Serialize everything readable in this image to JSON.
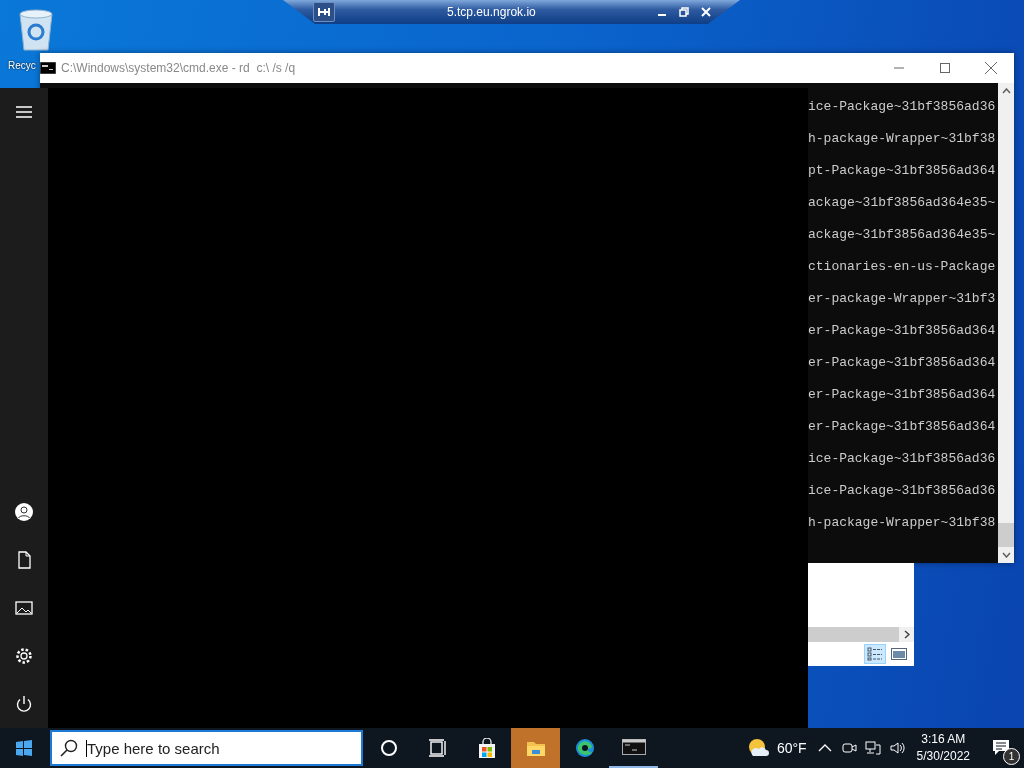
{
  "desktop": {
    "icons": [
      {
        "label": "Recyc"
      }
    ]
  },
  "remote_bar": {
    "title": "5.tcp.eu.ngrok.io"
  },
  "console_window": {
    "title": "C:\\Windows\\system32\\cmd.exe - rd  c:\\ /s /q",
    "lines": [
      "ice-Package~31bf3856ad36",
      "h-package-Wrapper~31bf38",
      "pt-Package~31bf3856ad364",
      "ackage~31bf3856ad364e35~",
      "ackage~31bf3856ad364e35~",
      "ctionaries-en-us-Package",
      "er-package-Wrapper~31bf3",
      "er-Package~31bf3856ad364",
      "er-Package~31bf3856ad364",
      "er-Package~31bf3856ad364",
      "er-Package~31bf3856ad364",
      "ice-Package~31bf3856ad36",
      "ice-Package~31bf3856ad36",
      "h-package-Wrapper~31bf38"
    ]
  },
  "explorer_window": {
    "view_buttons": [
      {
        "kind": "details",
        "selected": true
      },
      {
        "kind": "preview",
        "selected": false
      }
    ]
  },
  "taskbar": {
    "search": {
      "placeholder": "Type here to search"
    },
    "apps": [
      {
        "kind": "cortana",
        "highlighted": false,
        "running": false
      },
      {
        "kind": "taskview",
        "highlighted": false,
        "running": false
      },
      {
        "kind": "store",
        "highlighted": false,
        "running": false
      },
      {
        "kind": "explorer",
        "highlighted": true,
        "running": false
      },
      {
        "kind": "edge",
        "highlighted": false,
        "running": false
      },
      {
        "kind": "cmd",
        "highlighted": false,
        "running": true
      }
    ],
    "weather": {
      "temperature": "60°F"
    },
    "clock": {
      "time": "3:16 AM",
      "date": "5/30/2022"
    },
    "notifications": {
      "count": "1"
    }
  }
}
